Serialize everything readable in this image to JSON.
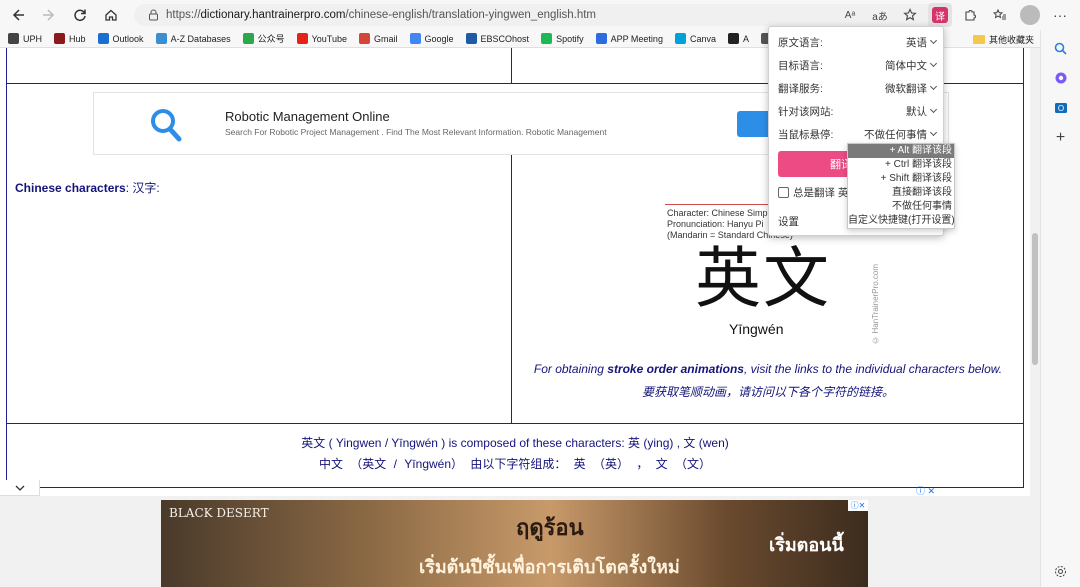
{
  "browser": {
    "url_prefix": "https://",
    "url_host": "dictionary.hantrainerpro.com",
    "url_path": "/chinese-english/translation-yingwen_english.htm",
    "ext_text_size": "Aᵃ",
    "ext_translate": "aあ",
    "ext_active": "译"
  },
  "bookmarks": [
    {
      "label": "UPH",
      "color": "#444"
    },
    {
      "label": "Hub",
      "color": "#8b1a1a"
    },
    {
      "label": "Outlook",
      "color": "#1a6fd0"
    },
    {
      "label": "A-Z Databases",
      "color": "#3b8ed0"
    },
    {
      "label": "公众号",
      "color": "#2ba84a"
    },
    {
      "label": "YouTube",
      "color": "#e62117"
    },
    {
      "label": "Gmail",
      "color": "#d44638"
    },
    {
      "label": "Google",
      "color": "#4285f4"
    },
    {
      "label": "EBSCOhost",
      "color": "#1f5aa6"
    },
    {
      "label": "Spotify",
      "color": "#1db954"
    },
    {
      "label": "APP Meeting",
      "color": "#2d6cdf"
    },
    {
      "label": "Canva",
      "color": "#00a3d9"
    },
    {
      "label": "A",
      "color": "#222"
    },
    {
      "label": "S",
      "color": "#555"
    }
  ],
  "bookmarks_other": "其他收藏夹",
  "ad_top": {
    "title": "Robotic Management Online",
    "subtitle": "Search For Robotic Project Management . Find The Most Relevant Information. Robotic Management"
  },
  "content": {
    "chinese_label_bold": "Chinese characters",
    "chinese_label_rest": ": 汉字:",
    "card_meta_1": "Character: Chinese Simp",
    "card_meta_2": "Pronunciation: Hanyu Pi",
    "card_meta_3": "(Mandarin = Standard Chinese)",
    "card_chars": "英文",
    "card_pinyin": "Yīngwén",
    "card_copyright": "© HanTrainerPro.com",
    "stroke_pre": "For obtaining ",
    "stroke_bold": "stroke order animations",
    "stroke_post": ", visit the links to the individual characters below.",
    "stroke_zh": "要获取笔顺动画，请访问以下各个字符的链接。",
    "composed_en": "英文 ( Yingwen / Yīngwén ) is composed of these characters: 英 (ying) , 文 (wen)",
    "composed_zh": "中文 （英文 / Yīngwén） 由以下字符组成： 英 （英） ， 文 （文）"
  },
  "banner": {
    "logo": "BLACK DESERT",
    "headline": "ฤดูร้อน",
    "subline": "เริ่มต้นปีชั้นเพื่อการเติบโตครั้งใหม่",
    "cta": "เริ่มตอนนี้"
  },
  "translator": {
    "rows": [
      {
        "label": "原文语言:",
        "value": "英语"
      },
      {
        "label": "目标语言:",
        "value": "简体中文"
      },
      {
        "label": "翻译服务:",
        "value": "微软翻译"
      },
      {
        "label": "针对该网站:",
        "value": "默认"
      },
      {
        "label": "当鼠标悬停:",
        "value": "不做任何事情"
      }
    ],
    "button": "翻译",
    "always_translate": "总是翻译 英",
    "settings": "设置",
    "hover_options": [
      "+ Alt 翻译该段",
      "+ Ctrl 翻译该段",
      "+ Shift 翻译该段",
      "直接翻译该段",
      "不做任何事情",
      "自定义快捷键(打开设置)"
    ],
    "selected_index": 0
  },
  "colors": {
    "accent_pink": "#ec4b84",
    "link_navy": "#14147a",
    "table_border": "#1f1f8f"
  }
}
